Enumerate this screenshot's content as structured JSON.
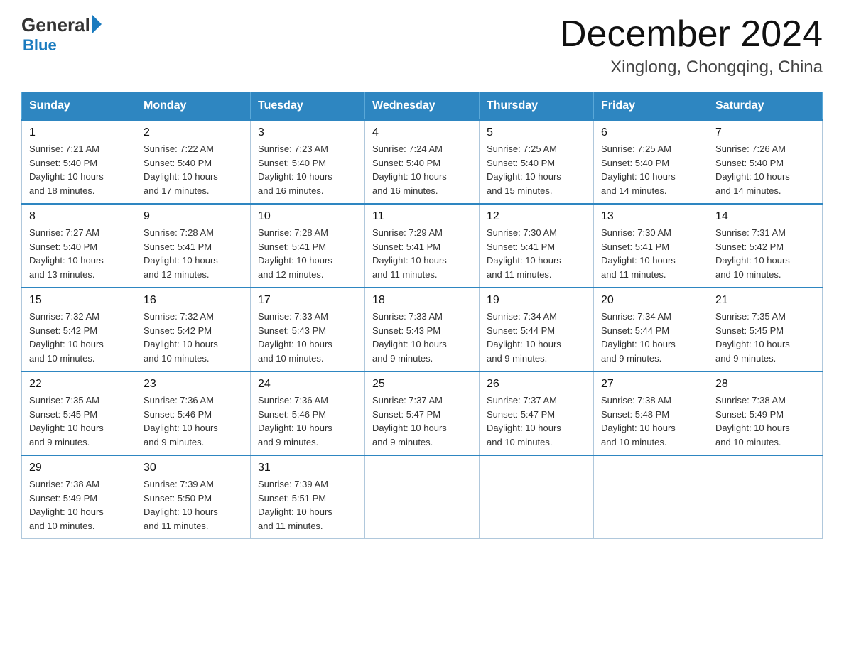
{
  "logo": {
    "general": "General",
    "arrow": "",
    "blue": "Blue"
  },
  "title": "December 2024",
  "location": "Xinglong, Chongqing, China",
  "days_of_week": [
    "Sunday",
    "Monday",
    "Tuesday",
    "Wednesday",
    "Thursday",
    "Friday",
    "Saturday"
  ],
  "weeks": [
    [
      {
        "day": "1",
        "sunrise": "7:21 AM",
        "sunset": "5:40 PM",
        "daylight": "10 hours and 18 minutes."
      },
      {
        "day": "2",
        "sunrise": "7:22 AM",
        "sunset": "5:40 PM",
        "daylight": "10 hours and 17 minutes."
      },
      {
        "day": "3",
        "sunrise": "7:23 AM",
        "sunset": "5:40 PM",
        "daylight": "10 hours and 16 minutes."
      },
      {
        "day": "4",
        "sunrise": "7:24 AM",
        "sunset": "5:40 PM",
        "daylight": "10 hours and 16 minutes."
      },
      {
        "day": "5",
        "sunrise": "7:25 AM",
        "sunset": "5:40 PM",
        "daylight": "10 hours and 15 minutes."
      },
      {
        "day": "6",
        "sunrise": "7:25 AM",
        "sunset": "5:40 PM",
        "daylight": "10 hours and 14 minutes."
      },
      {
        "day": "7",
        "sunrise": "7:26 AM",
        "sunset": "5:40 PM",
        "daylight": "10 hours and 14 minutes."
      }
    ],
    [
      {
        "day": "8",
        "sunrise": "7:27 AM",
        "sunset": "5:40 PM",
        "daylight": "10 hours and 13 minutes."
      },
      {
        "day": "9",
        "sunrise": "7:28 AM",
        "sunset": "5:41 PM",
        "daylight": "10 hours and 12 minutes."
      },
      {
        "day": "10",
        "sunrise": "7:28 AM",
        "sunset": "5:41 PM",
        "daylight": "10 hours and 12 minutes."
      },
      {
        "day": "11",
        "sunrise": "7:29 AM",
        "sunset": "5:41 PM",
        "daylight": "10 hours and 11 minutes."
      },
      {
        "day": "12",
        "sunrise": "7:30 AM",
        "sunset": "5:41 PM",
        "daylight": "10 hours and 11 minutes."
      },
      {
        "day": "13",
        "sunrise": "7:30 AM",
        "sunset": "5:41 PM",
        "daylight": "10 hours and 11 minutes."
      },
      {
        "day": "14",
        "sunrise": "7:31 AM",
        "sunset": "5:42 PM",
        "daylight": "10 hours and 10 minutes."
      }
    ],
    [
      {
        "day": "15",
        "sunrise": "7:32 AM",
        "sunset": "5:42 PM",
        "daylight": "10 hours and 10 minutes."
      },
      {
        "day": "16",
        "sunrise": "7:32 AM",
        "sunset": "5:42 PM",
        "daylight": "10 hours and 10 minutes."
      },
      {
        "day": "17",
        "sunrise": "7:33 AM",
        "sunset": "5:43 PM",
        "daylight": "10 hours and 10 minutes."
      },
      {
        "day": "18",
        "sunrise": "7:33 AM",
        "sunset": "5:43 PM",
        "daylight": "10 hours and 9 minutes."
      },
      {
        "day": "19",
        "sunrise": "7:34 AM",
        "sunset": "5:44 PM",
        "daylight": "10 hours and 9 minutes."
      },
      {
        "day": "20",
        "sunrise": "7:34 AM",
        "sunset": "5:44 PM",
        "daylight": "10 hours and 9 minutes."
      },
      {
        "day": "21",
        "sunrise": "7:35 AM",
        "sunset": "5:45 PM",
        "daylight": "10 hours and 9 minutes."
      }
    ],
    [
      {
        "day": "22",
        "sunrise": "7:35 AM",
        "sunset": "5:45 PM",
        "daylight": "10 hours and 9 minutes."
      },
      {
        "day": "23",
        "sunrise": "7:36 AM",
        "sunset": "5:46 PM",
        "daylight": "10 hours and 9 minutes."
      },
      {
        "day": "24",
        "sunrise": "7:36 AM",
        "sunset": "5:46 PM",
        "daylight": "10 hours and 9 minutes."
      },
      {
        "day": "25",
        "sunrise": "7:37 AM",
        "sunset": "5:47 PM",
        "daylight": "10 hours and 9 minutes."
      },
      {
        "day": "26",
        "sunrise": "7:37 AM",
        "sunset": "5:47 PM",
        "daylight": "10 hours and 10 minutes."
      },
      {
        "day": "27",
        "sunrise": "7:38 AM",
        "sunset": "5:48 PM",
        "daylight": "10 hours and 10 minutes."
      },
      {
        "day": "28",
        "sunrise": "7:38 AM",
        "sunset": "5:49 PM",
        "daylight": "10 hours and 10 minutes."
      }
    ],
    [
      {
        "day": "29",
        "sunrise": "7:38 AM",
        "sunset": "5:49 PM",
        "daylight": "10 hours and 10 minutes."
      },
      {
        "day": "30",
        "sunrise": "7:39 AM",
        "sunset": "5:50 PM",
        "daylight": "10 hours and 11 minutes."
      },
      {
        "day": "31",
        "sunrise": "7:39 AM",
        "sunset": "5:51 PM",
        "daylight": "10 hours and 11 minutes."
      },
      null,
      null,
      null,
      null
    ]
  ],
  "labels": {
    "sunrise": "Sunrise:",
    "sunset": "Sunset:",
    "daylight": "Daylight:"
  }
}
